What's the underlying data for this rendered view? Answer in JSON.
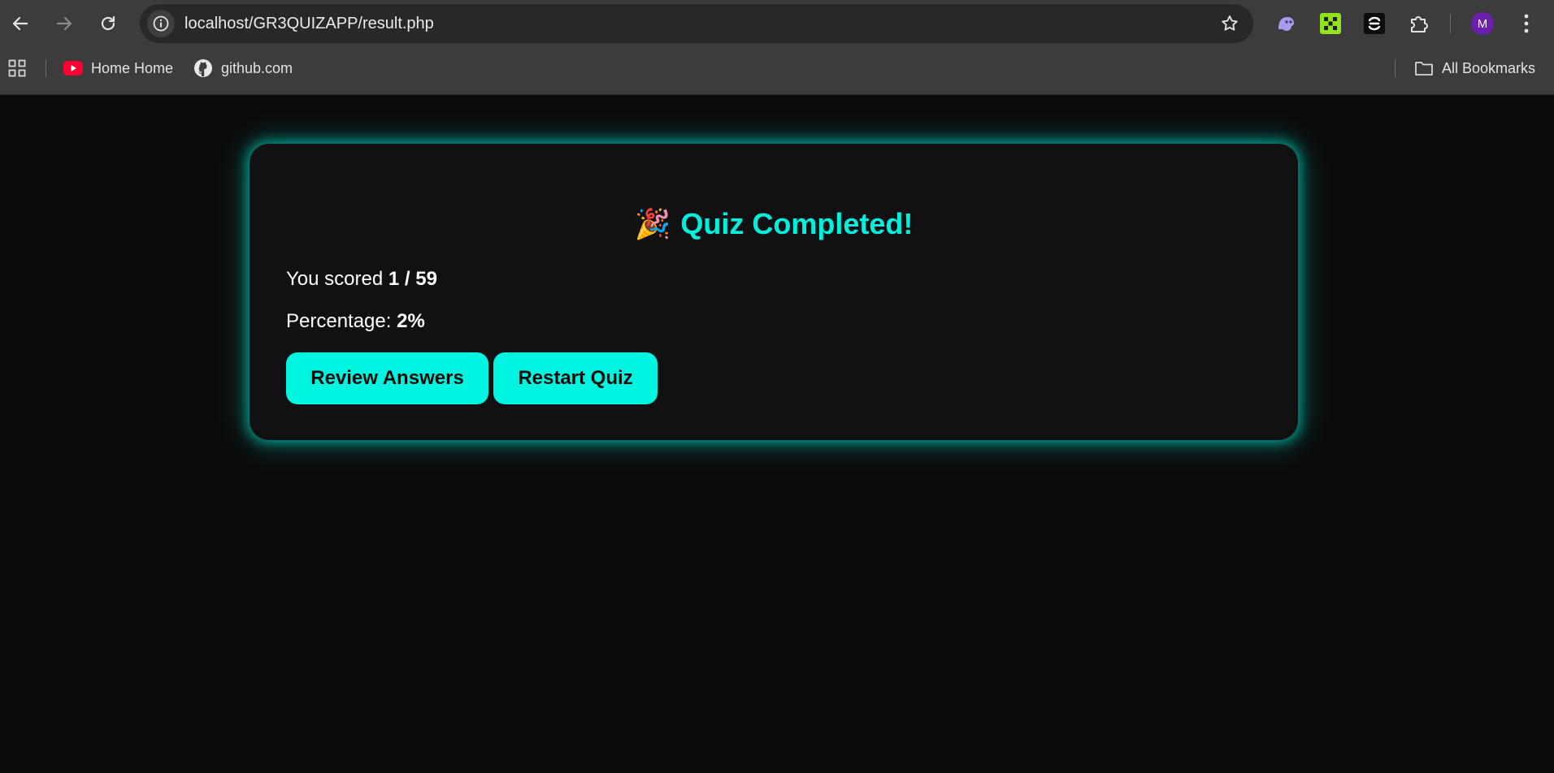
{
  "browser": {
    "url": "localhost/GR3QUIZAPP/result.php",
    "profile_initial": "M",
    "bookmarks": [
      {
        "label": "Home Home",
        "icon": "youtube-icon"
      },
      {
        "label": "github.com",
        "icon": "github-icon"
      }
    ],
    "all_bookmarks_label": "All Bookmarks"
  },
  "result": {
    "title_emoji": "🎉",
    "title": "Quiz Completed!",
    "score_prefix": "You scored",
    "score_value": "1 / 59",
    "percentage_prefix": "Percentage:",
    "percentage_value": "2%",
    "review_button": "Review Answers",
    "restart_button": "Restart Quiz"
  },
  "colors": {
    "accent": "#00f5e1",
    "title": "#00f0dd",
    "card_bg": "#111113",
    "page_bg": "#0b0b0c"
  }
}
